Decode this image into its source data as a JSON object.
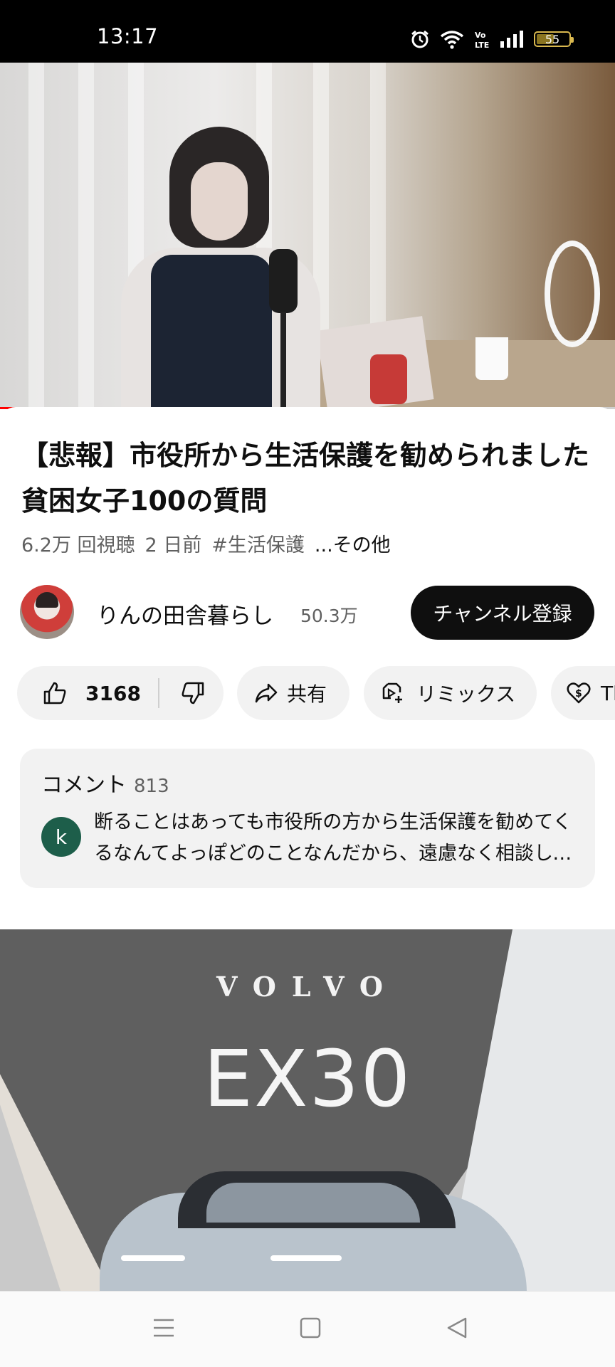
{
  "status_bar": {
    "time": "13:17",
    "battery_level": "55",
    "battery_fraction": 0.55,
    "icons": [
      "alarm-icon",
      "wifi-icon",
      "volte-icon",
      "signal-icon",
      "battery-icon"
    ]
  },
  "video": {
    "progress_fraction": 0.06,
    "title": "【悲報】市役所から生活保護を勧められました 貧困女子100の質問",
    "views": "6.2万 回視聴",
    "age": "2 日前",
    "hashtag": "#生活保護",
    "more_label": "...その他"
  },
  "channel": {
    "name": "りんの田舎暮らし",
    "subscribers": "50.3万",
    "subscribe_label": "チャンネル登録"
  },
  "actions": {
    "like_count": "3168",
    "share_label": "共有",
    "remix_label": "リミックス",
    "thanks_label": "Thanks"
  },
  "comments": {
    "heading": "コメント",
    "count": "813",
    "commenter_initial": "k",
    "top_comment": "断ることはあっても市役所の方から生活保護を勧めてくるなんてよっぽどのことなんだから、遠慮なく相談してね"
  },
  "ad": {
    "brand": "VOLVO",
    "model": "EX30"
  },
  "colors": {
    "accent_red": "#ff0000",
    "subscribe_bg": "#0f0f0f",
    "pill_bg": "#f2f2f2",
    "commenter_avatar": "#1d5e4a"
  },
  "nav": {
    "icons": [
      "menu-icon",
      "home-square-icon",
      "back-triangle-icon"
    ]
  }
}
